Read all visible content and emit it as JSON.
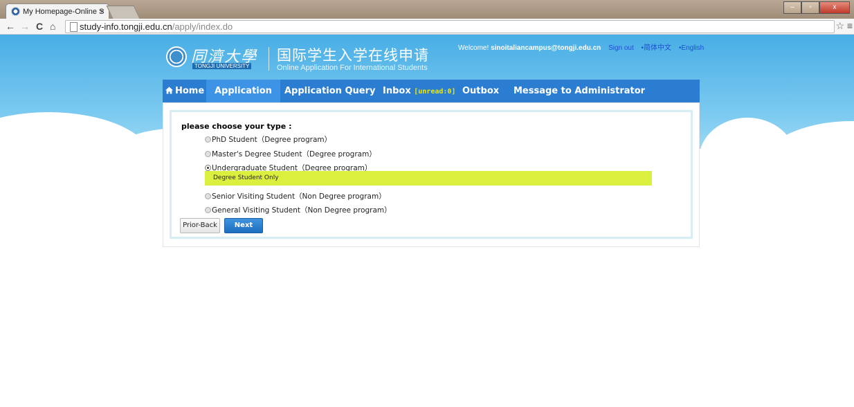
{
  "browser": {
    "tab_title": "My Homepage-Online S",
    "tab_close": "×",
    "url_host": "study-info.tongji.edu.cn",
    "url_path": "/apply/index.do",
    "back": "←",
    "forward": "→",
    "reload": "C",
    "home": "⌂",
    "star": "☆",
    "menu": "≡",
    "win_min": "–",
    "win_max": "▫",
    "win_close": "x"
  },
  "header": {
    "logo_cn": "同濟大學",
    "logo_en": "TONGJI UNIVERSITY",
    "title_cn": "国际学生入学在线申请",
    "title_en": "Online Application For International Students",
    "welcome": "Welcome!",
    "user": "sinoitaliancampus@tongji.edu.cn",
    "sign_out": "Sign out",
    "lang_cn": "•简体中文",
    "lang_en": "•English"
  },
  "nav": {
    "home": "Home",
    "application": "Application",
    "query": "Application Query",
    "inbox": "Inbox",
    "inbox_unread": "[unread:0]",
    "outbox": "Outbox",
    "message": "Message to Administrator"
  },
  "form": {
    "question": "please choose your type :",
    "options": [
      "PhD Student（Degree program）",
      "Master's Degree Student（Degree program）",
      "Undergraduate Student（Degree program）",
      "Senior Visiting Student（Non Degree program）",
      "General Visiting Student（Non Degree program）"
    ],
    "selected_index": 2,
    "hint": "Degree Student Only",
    "back_label": "Prior-Back",
    "next_label": "Next"
  },
  "colors": {
    "nav_bg": "#2a7dd0",
    "nav_active": "#3d94e6",
    "hint_bg": "#dbef3f",
    "sky": "#48aee5"
  }
}
